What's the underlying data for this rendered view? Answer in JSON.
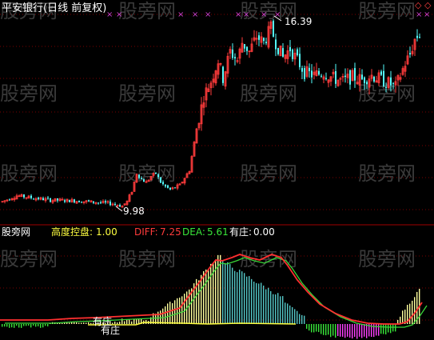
{
  "main_panel": {
    "title": "平安银行(日线 前复权)",
    "high_label": "16.39",
    "low_label": "9.98"
  },
  "indicator_panel": {
    "name": "股旁网",
    "items": [
      {
        "label": "高度控盘:",
        "value": "1.00",
        "color": "#ffff40"
      },
      {
        "label": "DIFF:",
        "value": "7.25",
        "color": "#ff3b3b"
      },
      {
        "label": "DEA:",
        "value": "5.61",
        "color": "#39e639"
      },
      {
        "label": "有庄:",
        "value": "0.00",
        "color": "#ffffff"
      }
    ],
    "annotations": [
      "有庄",
      "有庄"
    ]
  },
  "watermark": "股旁网",
  "colors": {
    "up": "#ff3b3b",
    "down": "#54ffff",
    "grid": "#7a0000",
    "diff": "#ff3030",
    "dea": "#39d639",
    "macd_up": "#ffff9e",
    "macd_down": "#54c7c7",
    "neg_bar": "#ff40ff",
    "neg_green": "#39e639",
    "marker": "#d040d0"
  },
  "chart_data": {
    "type": "candlestick",
    "symbol": "平安银行",
    "period": "日线",
    "adjust": "前复权",
    "high": 16.39,
    "low": 9.98,
    "indicator": {
      "高度控盘": 1.0,
      "DIFF": 7.25,
      "DEA": 5.61,
      "有庄": 0.0
    }
  }
}
